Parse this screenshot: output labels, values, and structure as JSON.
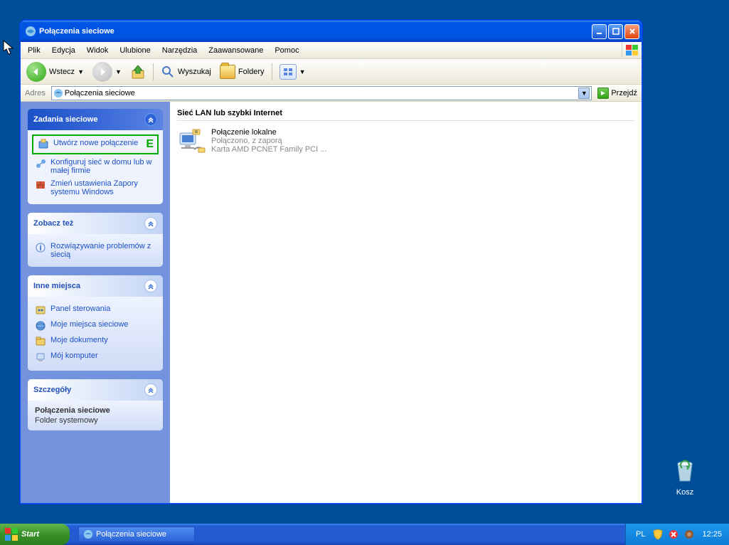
{
  "window": {
    "title": "Połączenia sieciowe"
  },
  "menubar": [
    "Plik",
    "Edycja",
    "Widok",
    "Ulubione",
    "Narzędzia",
    "Zaawansowane",
    "Pomoc"
  ],
  "toolbar": {
    "back": "Wstecz",
    "search": "Wyszukaj",
    "folders": "Foldery"
  },
  "addressbar": {
    "label": "Adres",
    "value": "Połączenia sieciowe",
    "go": "Przejdź"
  },
  "sidebar": {
    "panels": [
      {
        "title": "Zadania sieciowe",
        "items": [
          "Utwórz nowe połączenie",
          "Konfiguruj sieć w domu lub w małej firmie",
          "Zmień ustawienia Zapory systemu Windows"
        ],
        "highlight_letter": "E"
      },
      {
        "title": "Zobacz też",
        "items": [
          "Rozwiązywanie problemów z siecią"
        ]
      },
      {
        "title": "Inne miejsca",
        "items": [
          "Panel sterowania",
          "Moje miejsca sieciowe",
          "Moje dokumenty",
          "Mój komputer"
        ]
      },
      {
        "title": "Szczegóły",
        "detail_title": "Połączenia sieciowe",
        "detail_sub": "Folder systemowy"
      }
    ]
  },
  "content": {
    "category": "Sieć LAN lub szybki Internet",
    "connection": {
      "name": "Połączenie lokalne",
      "status": "Połączono, z zaporą",
      "adapter": "Karta AMD PCNET Family PCI ..."
    }
  },
  "desktop": {
    "recycle": "Kosz"
  },
  "taskbar": {
    "start": "Start",
    "task": "Połączenia sieciowe",
    "lang": "PL",
    "time": "12:25"
  }
}
